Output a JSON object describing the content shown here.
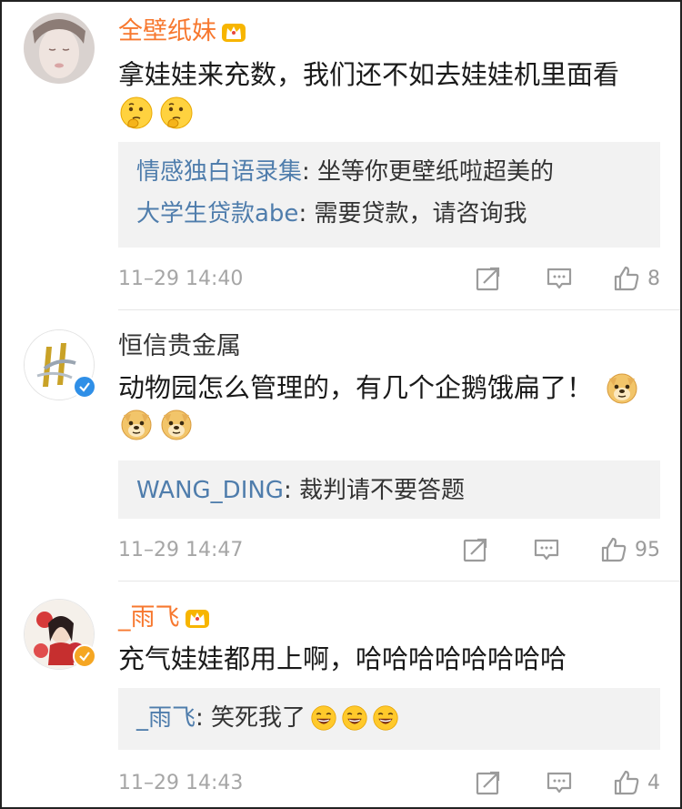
{
  "comments": [
    {
      "username": "全壁纸妹",
      "text": "拿娃娃来充数，我们还不如去娃娃机里面看",
      "replies": [
        {
          "name": "情感独白语录集",
          "sep": ": ",
          "text": "坐等你更壁纸啦超美的"
        },
        {
          "name": "大学生贷款abe",
          "sep": ": ",
          "text": "需要贷款，请咨询我"
        }
      ],
      "time": "11–29 14:40",
      "likes": "8"
    },
    {
      "username": "恒信贵金属",
      "text": "动物园怎么管理的，有几个企鹅饿扁了！",
      "replies": [
        {
          "name": "WANG_DING",
          "sep": ": ",
          "text": "裁判请不要答题"
        }
      ],
      "time": "11–29 14:47",
      "likes": "95"
    },
    {
      "username": "_雨飞",
      "text": "充气娃娃都用上啊，哈哈哈哈哈哈哈哈",
      "replies": [
        {
          "name": "_雨飞",
          "sep": ": ",
          "text": "笑死我了"
        }
      ],
      "time": "11–29 14:43",
      "likes": "4"
    }
  ],
  "icons": {
    "vip_crown": "crown-icon",
    "thinking_emoji": "thinking-face-emoji",
    "doge_emoji": "doge-emoji",
    "laugh_emoji": "laughing-face-emoji",
    "repost": "repost-icon",
    "reply": "comment-icon",
    "like": "thumbs-up-icon"
  },
  "colors": {
    "vip_name": "#f7782f",
    "reply_name": "#4f7dac",
    "meta": "#a6a6a6",
    "reply_bg": "#f2f2f2"
  }
}
